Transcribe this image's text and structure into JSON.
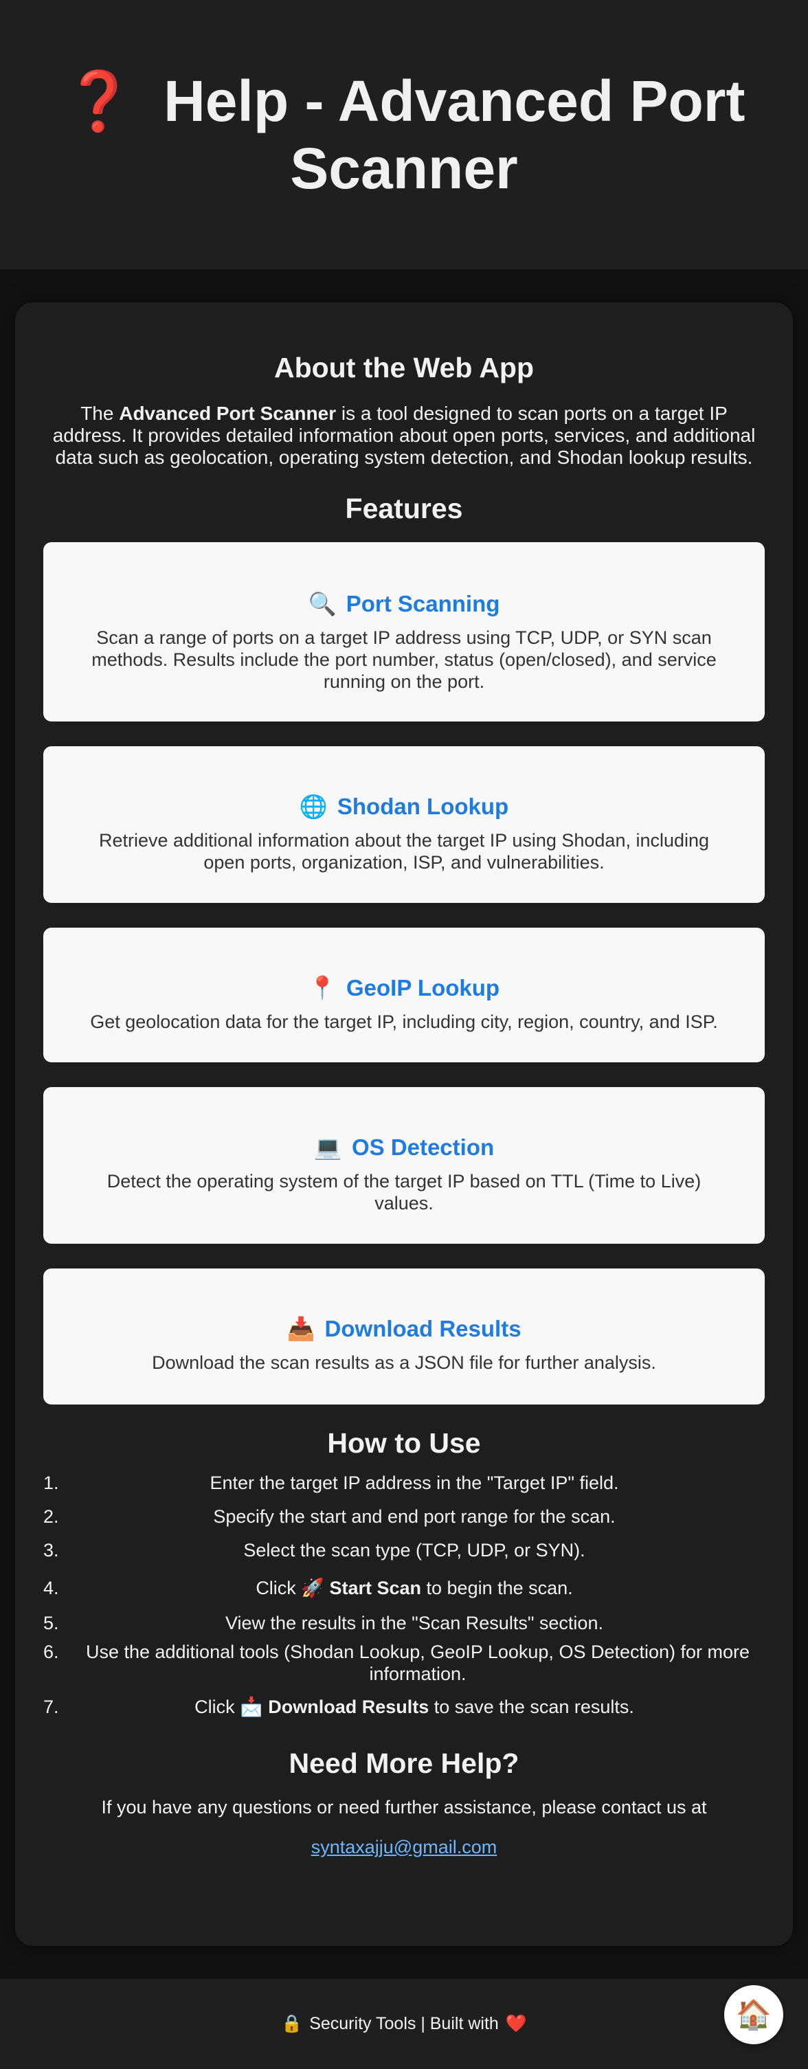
{
  "header": {
    "icon": "❓",
    "title": "Help - Advanced Port Scanner"
  },
  "about": {
    "title": "About the Web App",
    "text_prefix": "The ",
    "text_bold": "Advanced Port Scanner",
    "text_suffix": " is a tool designed to scan ports on a target IP address. It provides detailed information about open ports, services, and additional data such as geolocation, operating system detection, and Shodan lookup results."
  },
  "features": {
    "title": "Features",
    "items": [
      {
        "icon": "🔍",
        "title": "Port Scanning",
        "description": "Scan a range of ports on a target IP address using TCP, UDP, or SYN scan methods. Results include the port number, status (open/closed), and service running on the port."
      },
      {
        "icon": "🌐",
        "title": "Shodan Lookup",
        "description": "Retrieve additional information about the target IP using Shodan, including open ports, organization, ISP, and vulnerabilities."
      },
      {
        "icon": "📍",
        "title": "GeoIP Lookup",
        "description": "Get geolocation data for the target IP, including city, region, country, and ISP."
      },
      {
        "icon": "💻",
        "title": "OS Detection",
        "description": "Detect the operating system of the target IP based on TTL (Time to Live) values."
      },
      {
        "icon": "📥",
        "title": "Download Results",
        "description": "Download the scan results as a JSON file for further analysis."
      }
    ]
  },
  "how_to_use": {
    "title": "How to Use",
    "steps": [
      {
        "num": "1.",
        "text": "Enter the target IP address in the \"Target IP\" field."
      },
      {
        "num": "2.",
        "text": "Specify the start and end port range for the scan."
      },
      {
        "num": "3.",
        "text": "Select the scan type (TCP, UDP, or SYN)."
      },
      {
        "num": "4.",
        "pre": "Click ",
        "icon": "🚀",
        "bold": "Start Scan",
        "post": " to begin the scan."
      },
      {
        "num": "5.",
        "text": "View the results in the \"Scan Results\" section."
      },
      {
        "num": "6.",
        "text": "Use the additional tools (Shodan Lookup, GeoIP Lookup, OS Detection) for more information."
      },
      {
        "num": "7.",
        "pre": "Click ",
        "icon": "📩",
        "bold": "Download Results",
        "post": " to save the scan results."
      }
    ]
  },
  "help": {
    "title": "Need More Help?",
    "text": "If you have any questions or need further assistance, please contact us at",
    "email": "syntaxajju@gmail.com"
  },
  "footer": {
    "lock_icon": "🔒",
    "text": "Security Tools | Built with",
    "heart_icon": "❤️"
  },
  "home_button": {
    "icon": "🏠"
  }
}
